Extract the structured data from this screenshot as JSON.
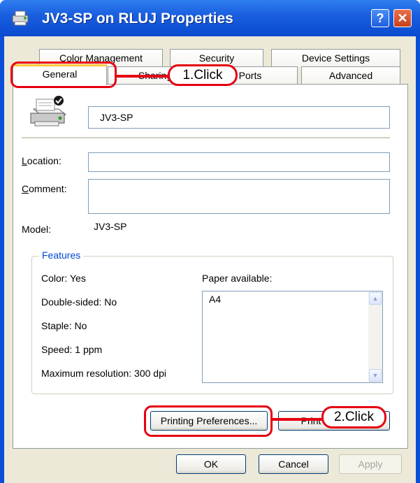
{
  "window": {
    "title": "JV3-SP  on RLUJ Properties",
    "help_icon": "?",
    "close_icon": "✕"
  },
  "tabs": {
    "row1": [
      "Color Management",
      "Security",
      "Device Settings"
    ],
    "row2": [
      "General",
      "Sharing",
      "Ports",
      "Advanced"
    ],
    "active": "General"
  },
  "general": {
    "printer_name": "JV3-SP",
    "location_label": "Location:",
    "location_value": "",
    "comment_label": "Comment:",
    "comment_value": "",
    "model_label": "Model:",
    "model_value": "JV3-SP"
  },
  "features": {
    "title": "Features",
    "color": "Color: Yes",
    "double_sided": "Double-sided: No",
    "staple": "Staple: No",
    "speed": "Speed: 1 ppm",
    "max_resolution": "Maximum resolution: 300 dpi",
    "paper_label": "Paper available:",
    "paper_items": [
      "A4"
    ]
  },
  "buttons": {
    "printing_preferences": "Printing Preferences...",
    "print_test_page": "Print Test Page",
    "ok": "OK",
    "cancel": "Cancel",
    "apply": "Apply"
  },
  "annotations": {
    "step1": "1.Click",
    "step2": "2.Click",
    "color": "#e60012"
  },
  "icons": {
    "window_icon": "printer-icon",
    "printer_icon": "printer-icon",
    "scroll_up": "scroll-up-icon",
    "scroll_down": "scroll-down-icon"
  }
}
